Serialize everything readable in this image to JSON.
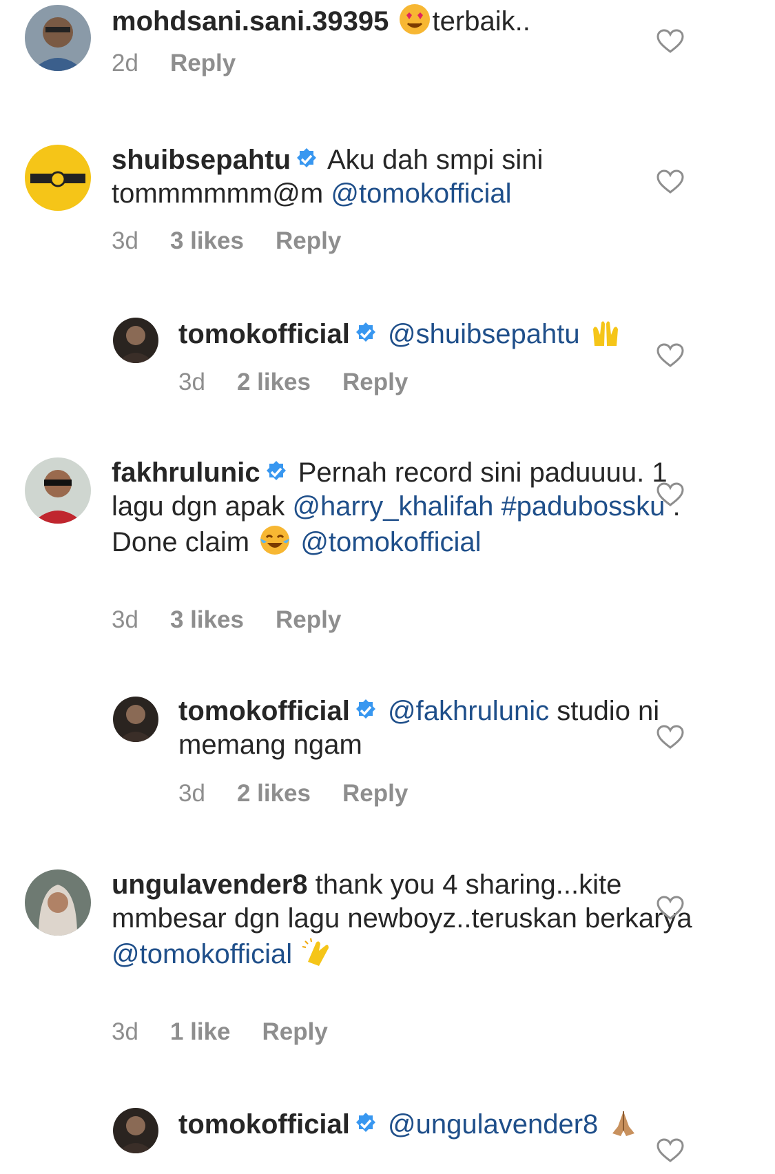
{
  "comments": [
    {
      "user": "mohdsani.sani.39395",
      "verified": false,
      "pre": "",
      "emoji": "heart-eyes",
      "text": "terbaik..",
      "time": "2d",
      "likes": "",
      "reply": "Reply"
    },
    {
      "user": "shuibsepahtu",
      "verified": true,
      "text": "Aku dah smpi sini tommmmmm@m",
      "mention": "@tomokofficial",
      "time": "3d",
      "likes": "3 likes",
      "reply": "Reply"
    },
    {
      "user": "tomokofficial",
      "verified": true,
      "mention": "@shuibsepahtu",
      "emoji": "raising-hands",
      "time": "3d",
      "likes": "2 likes",
      "reply": "Reply"
    },
    {
      "user": "fakhrulunic",
      "verified": true,
      "text1": "Pernah record sini paduuuu. 1 lagu dgn apak",
      "mention1": "@harry_khalifah",
      "hashtag": "#padubossku",
      "text2": ". Done claim",
      "emoji": "tears-of-joy",
      "mention2": "@tomokofficial",
      "time": "3d",
      "likes": "3 likes",
      "reply": "Reply"
    },
    {
      "user": "tomokofficial",
      "verified": true,
      "mention": "@fakhrulunic",
      "text": "studio ni memang ngam",
      "time": "3d",
      "likes": "2 likes",
      "reply": "Reply"
    },
    {
      "user": "ungulavender8",
      "verified": false,
      "text": "thank you 4 sharing...kite mmbesar dgn lagu newboyz..teruskan berkarya",
      "mention": "@tomokofficial",
      "emoji": "clapping-hands",
      "time": "3d",
      "likes": "1 like",
      "reply": "Reply"
    },
    {
      "user": "tomokofficial",
      "verified": true,
      "mention": "@ungulavender8",
      "emoji": "folded-hands",
      "time": "",
      "likes": "",
      "reply": ""
    }
  ],
  "colors": {
    "mention": "#1f4f8a",
    "meta": "#8e8e8e",
    "verified": "#3897f0"
  }
}
